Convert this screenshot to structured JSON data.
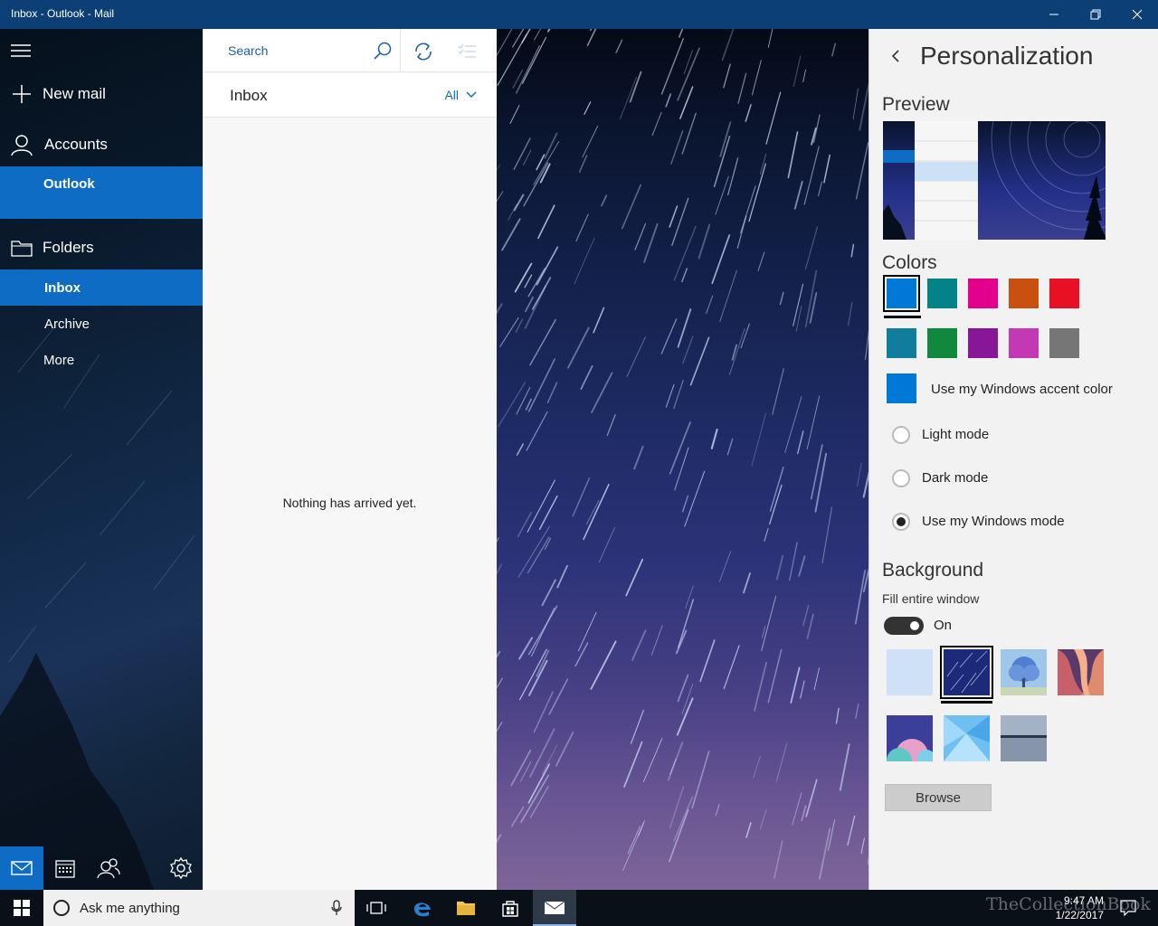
{
  "window": {
    "title": "Inbox - Outlook - Mail"
  },
  "nav": {
    "new_mail": "New mail",
    "accounts": "Accounts",
    "account_name": "Outlook",
    "folders": "Folders",
    "folder_items": [
      "Inbox",
      "Archive",
      "More"
    ]
  },
  "list": {
    "search_placeholder": "Search",
    "folder_title": "Inbox",
    "filter": "All",
    "empty_message": "Nothing has arrived yet."
  },
  "personalization": {
    "title": "Personalization",
    "preview_heading": "Preview",
    "colors_heading": "Colors",
    "colors": [
      "#0078d7",
      "#038387",
      "#e3008c",
      "#ca5010",
      "#e81123",
      "#0f7d9b",
      "#10893e",
      "#881798",
      "#c239b3",
      "#767676"
    ],
    "selected_color": "#0078d7",
    "accent_label": "Use my Windows accent color",
    "modes": [
      "Light mode",
      "Dark mode",
      "Use my Windows mode"
    ],
    "selected_mode": "Use my Windows mode",
    "background_heading": "Background",
    "fill_label": "Fill entire window",
    "fill_state": "On",
    "browse_label": "Browse"
  },
  "taskbar": {
    "search_text": "Ask me anything",
    "time": "9:47 AM",
    "date": "1/22/2017"
  },
  "watermark": "TheCollectionBook",
  "colors": {
    "title_bar": "#0b3f76",
    "accent": "#0e6cc4"
  }
}
